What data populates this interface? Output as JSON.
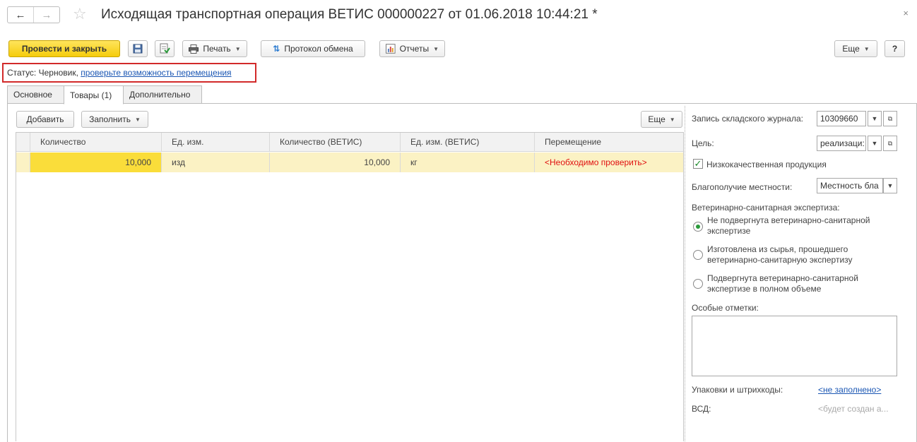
{
  "window": {
    "title": "Исходящая транспортная операция ВЕТИС 000000227 от 01.06.2018 10:44:21 *",
    "close": "×",
    "back": "←",
    "forward": "→",
    "favorite": "☆"
  },
  "toolbar": {
    "post_close": "Провести и закрыть",
    "print": "Печать",
    "protocol": "Протокол обмена",
    "reports": "Отчеты",
    "more": "Еще",
    "help": "?"
  },
  "status": {
    "prefix": "Статус: Черновик,",
    "link": "проверьте возможность перемещения"
  },
  "tabs": [
    {
      "label": "Основное"
    },
    {
      "label": "Товары (1)",
      "active": true
    },
    {
      "label": "Дополнительно"
    }
  ],
  "table_toolbar": {
    "add": "Добавить",
    "fill": "Заполнить",
    "more": "Еще"
  },
  "table": {
    "columns": [
      "Количество",
      "Ед. изм.",
      "Количество (ВЕТИС)",
      "Ед. изм. (ВЕТИС)",
      "Перемещение"
    ],
    "rows": [
      [
        "10,000",
        "изд",
        "10,000",
        "кг",
        "<Необходимо проверить>"
      ]
    ]
  },
  "side": {
    "journal_label": "Запись складского журнала:",
    "journal_value": "10309660",
    "purpose_label": "Цель:",
    "purpose_value": "реализаци:",
    "low_quality": "Низкокачественная продукция",
    "locality_label": "Благополучие местности:",
    "locality_value": "Местность бла",
    "expertise_label": "Ветеринарно-санитарная экспертиза:",
    "expertise_options": [
      {
        "line1": "Не подвергнута ветеринарно-санитарной",
        "line2": "экспертизе",
        "selected": true
      },
      {
        "line1": "Изготовлена из сырья, прошедшего",
        "line2": "ветеринарно-санитарную экспертизу",
        "selected": false
      },
      {
        "line1": "Подвергнута ветеринарно-санитарной",
        "line2": "экспертизе в полном объеме",
        "selected": false
      }
    ],
    "notes_label": "Особые отметки:",
    "packages_label": "Упаковки и штрихкоды:",
    "packages_value": "<не заполнено>",
    "vsd_label": "ВСД:",
    "vsd_value": "<будет создан а..."
  }
}
